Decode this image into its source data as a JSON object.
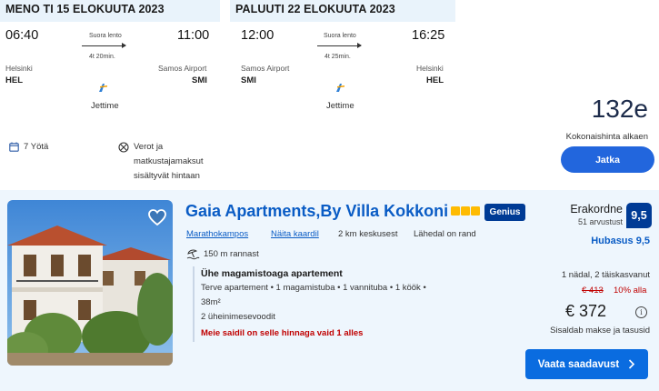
{
  "outbound": {
    "header": "MENO TI 15 ELOKUUTA 2023",
    "depart_time": "06:40",
    "arrive_time": "11:00",
    "flight_type": "Suora lento",
    "duration": "4t 20min.",
    "from_city": "Helsinki",
    "from_code": "HEL",
    "to_city": "Samos Airport",
    "to_code": "SMI",
    "airline": "Jettime"
  },
  "inbound": {
    "header": "PALUUTI 22 ELOKUUTA 2023",
    "depart_time": "12:00",
    "arrive_time": "16:25",
    "flight_type": "Suora lento",
    "duration": "4t 25min.",
    "from_city": "Samos Airport",
    "from_code": "SMI",
    "to_city": "Helsinki",
    "to_code": "HEL",
    "airline": "Jettime"
  },
  "package": {
    "nights": "7 Yötä",
    "taxes_note_lines": [
      "Verot ja",
      "matkustajamaksut",
      "sisältyvät hintaan"
    ],
    "price": "132e",
    "price_caption": "Kokonaishinta alkaen",
    "continue_label": "Jatka"
  },
  "hotel": {
    "name": "Gaia Apartments,By Villa Kokkoni",
    "genius_label": "Genius",
    "star_count": 3,
    "location_link": "Marathokampos",
    "map_link": "Näita kaardil",
    "distance_center": "2 km keskusest",
    "near_beach": "Lähedal on rand",
    "beach_distance": "150 m rannast",
    "room_title": "Ühe magamistoaga apartement",
    "room_details_line1": "Terve apartement • 1 magamistuba • 1 vannituba • 1 köök •",
    "room_details_line2": "38m²",
    "beds": "2 üheinimesevoodit",
    "availability_warning": "Meie saidil on selle hinnaga vaid 1 alles",
    "rating_word": "Erakordne",
    "review_count": "51 arvustust",
    "score": "9,5",
    "comfort": "Hubasus 9,5",
    "stay_length": "1 nädal, 2 täiskasvanut",
    "old_price": "€ 413",
    "discount": "10% alla",
    "new_price": "€ 372",
    "taxes_included": "Sisaldab makse ja tasusid",
    "availability_button": "Vaata saadavust"
  },
  "colors": {
    "brand_blue": "#0a6ce0",
    "link_blue": "#0a5cc5",
    "genius_navy": "#003b95",
    "star_gold": "#febb02",
    "warning_red": "#c00000",
    "header_bg": "#e9f3fb",
    "card_bg": "#eef6fd"
  }
}
